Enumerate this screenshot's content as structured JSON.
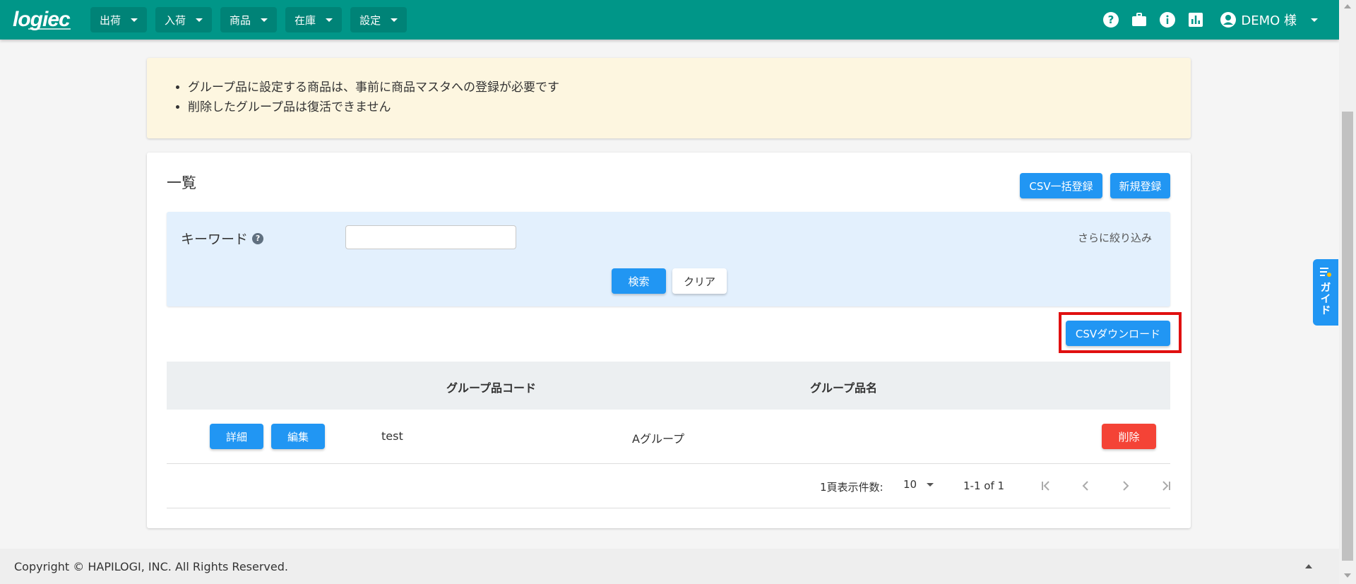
{
  "brand": {
    "logo_text": "logiec"
  },
  "nav": [
    {
      "label": "出荷"
    },
    {
      "label": "入荷"
    },
    {
      "label": "商品"
    },
    {
      "label": "在庫"
    },
    {
      "label": "設定"
    }
  ],
  "header_icons": [
    "help-icon",
    "briefcase-icon",
    "info-icon",
    "bar-chart-icon",
    "account-icon"
  ],
  "user": {
    "name": "DEMO 様"
  },
  "notice": {
    "items": [
      "グループ品に設定する商品は、事前に商品マスタへの登録が必要です",
      "削除したグループ品は復活できません"
    ]
  },
  "card": {
    "title": "一覧",
    "csv_bulk_register_label": "CSV一括登録",
    "new_register_label": "新規登録"
  },
  "filter": {
    "keyword_label": "キーワード",
    "keyword_value": "",
    "more_label": "さらに絞り込み",
    "search_label": "検索",
    "clear_label": "クリア"
  },
  "csv_download_label": "CSVダウンロード",
  "table": {
    "columns": [
      "グループ品コード",
      "グループ品名"
    ],
    "rows": [
      {
        "detail_label": "詳細",
        "edit_label": "編集",
        "code": "test",
        "name": "Aグループ",
        "delete_label": "削除"
      }
    ]
  },
  "pager": {
    "per_page_label": "1頁表示件数:",
    "per_page_value": "10",
    "range_text": "1-1 of 1"
  },
  "guide": {
    "label": "ガイド"
  },
  "footer": {
    "copyright": "Copyright © HAPILOGI, INC. All Rights Reserved."
  },
  "colors": {
    "header": "#009688",
    "primary": "#2196f3",
    "danger": "#f44336",
    "notice_bg": "#fdf6e0",
    "filter_bg": "#e3f0fd",
    "highlight": "#e01010"
  }
}
